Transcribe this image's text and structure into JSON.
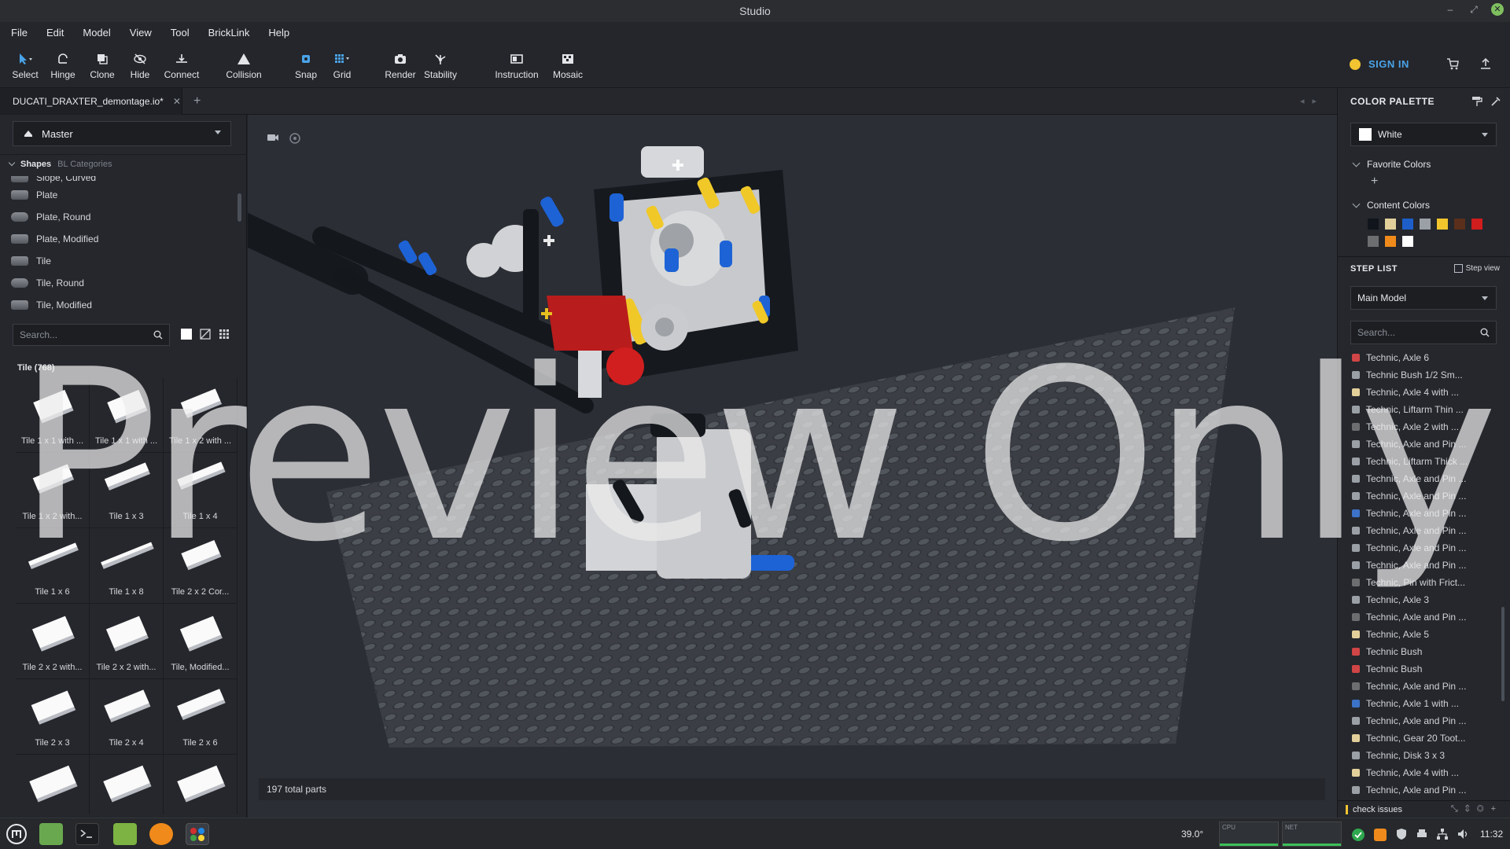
{
  "window": {
    "title": "Studio",
    "minimize": "–",
    "maximize": "⤢",
    "close": "✕"
  },
  "menu": [
    "File",
    "Edit",
    "Model",
    "View",
    "Tool",
    "BrickLink",
    "Help"
  ],
  "toolbar": {
    "tools": [
      {
        "label": "Select",
        "icon": "cursor-icon"
      },
      {
        "label": "Hinge",
        "icon": "hinge-icon"
      },
      {
        "label": "Clone",
        "icon": "clone-icon"
      },
      {
        "label": "Hide",
        "icon": "hide-icon"
      },
      {
        "label": "Connect",
        "icon": "connect-icon"
      },
      {
        "label": "Collision",
        "icon": "collision-icon"
      },
      {
        "label": "Snap",
        "icon": "snap-icon"
      },
      {
        "label": "Grid",
        "icon": "grid-icon"
      },
      {
        "label": "Render",
        "icon": "camera-icon"
      },
      {
        "label": "Stability",
        "icon": "stability-icon"
      },
      {
        "label": "Instruction",
        "icon": "instruction-icon"
      },
      {
        "label": "Mosaic",
        "icon": "mosaic-icon"
      }
    ],
    "sign_in": "SIGN IN",
    "accent": "#4aa3e8"
  },
  "tabs": {
    "file_name": "DUCATI_DRAXTER_demontage.io*",
    "close": "✕",
    "add": "+",
    "nav": "◂▸"
  },
  "left_panel": {
    "model_select": "Master",
    "shapes_tab": "Shapes",
    "categories_tab": "BL Categories",
    "categories": [
      "Slope, Curved",
      "Plate",
      "Plate, Round",
      "Plate, Modified",
      "Tile",
      "Tile, Round",
      "Tile, Modified"
    ],
    "search_placeholder": "Search...",
    "group_title": "Tile (768)",
    "parts": [
      "Tile 1 x 1 with ...",
      "Tile 1 x 1 with ...",
      "Tile 1 x 2 with ...",
      "Tile 1 x 2 with...",
      "Tile 1 x 3",
      "Tile 1 x 4",
      "Tile 1 x 6",
      "Tile 1 x 8",
      "Tile 2 x 2 Cor...",
      "Tile 2 x 2 with...",
      "Tile 2 x 2 with...",
      "Tile, Modified...",
      "Tile 2 x 3",
      "Tile 2 x 4",
      "Tile 2 x 6",
      "",
      "",
      ""
    ]
  },
  "viewport": {
    "status": "197 total parts",
    "watermark": "Preview Only"
  },
  "right_panel": {
    "color_palette_title": "COLOR PALETTE",
    "current_color": "White",
    "favorite_colors": "Favorite Colors",
    "favorite_add": "+",
    "content_colors": "Content Colors",
    "swatches": [
      "#10151c",
      "#e3cf9a",
      "#1d5ec9",
      "#9aa0a6",
      "#f2c52d",
      "#5a2f1c",
      "#d01d1d",
      "#6c6e70",
      "#f08a1a",
      "#ffffff"
    ],
    "step_list_title": "STEP LIST",
    "step_view": "Step view",
    "model_select": "Main Model",
    "search_placeholder": "Search...",
    "steps": [
      {
        "label": "Technic, Axle 6",
        "color": "#d04545"
      },
      {
        "label": "Technic Bush 1/2 Sm...",
        "color": "#9aa0a6"
      },
      {
        "label": "Technic, Axle 4 with ...",
        "color": "#e3cf9a"
      },
      {
        "label": "Technic, Liftarm Thin ...",
        "color": "#9aa0a6"
      },
      {
        "label": "Technic, Axle 2 with ...",
        "color": "#6c6e70"
      },
      {
        "label": "Technic, Axle and Pin ...",
        "color": "#9aa0a6"
      },
      {
        "label": "Technic, Liftarm Thick ...",
        "color": "#9aa0a6"
      },
      {
        "label": "Technic, Axle and Pin ...",
        "color": "#9aa0a6"
      },
      {
        "label": "Technic, Axle and Pin ...",
        "color": "#9aa0a6"
      },
      {
        "label": "Technic, Axle and Pin ...",
        "color": "#3c72c8"
      },
      {
        "label": "Technic, Axle and Pin ...",
        "color": "#9aa0a6"
      },
      {
        "label": "Technic, Axle and Pin ...",
        "color": "#9aa0a6"
      },
      {
        "label": "Technic, Axle and Pin ...",
        "color": "#9aa0a6"
      },
      {
        "label": "Technic, Pin with Frict...",
        "color": "#6c6e70"
      },
      {
        "label": "Technic, Axle 3",
        "color": "#9aa0a6"
      },
      {
        "label": "Technic, Axle and Pin ...",
        "color": "#6c6e70"
      },
      {
        "label": "Technic, Axle 5",
        "color": "#e3cf9a"
      },
      {
        "label": "Technic Bush",
        "color": "#d04545"
      },
      {
        "label": "Technic Bush",
        "color": "#d04545"
      },
      {
        "label": "Technic, Axle and Pin ...",
        "color": "#6c6e70"
      },
      {
        "label": "Technic, Axle 1 with ...",
        "color": "#3c72c8"
      },
      {
        "label": "Technic, Axle and Pin ...",
        "color": "#9aa0a6"
      },
      {
        "label": "Technic, Gear 20 Toot...",
        "color": "#e3cf9a"
      },
      {
        "label": "Technic, Disk 3 x 3",
        "color": "#9aa0a6"
      },
      {
        "label": "Technic, Axle 4 with ...",
        "color": "#e3cf9a"
      },
      {
        "label": "Technic, Axle and Pin ...",
        "color": "#9aa0a6"
      }
    ],
    "check_issues": "check issues"
  },
  "taskbar": {
    "zoom": "39.0°",
    "cpu_graph": "CPU",
    "net_graph": "NET",
    "time": "11:32"
  }
}
